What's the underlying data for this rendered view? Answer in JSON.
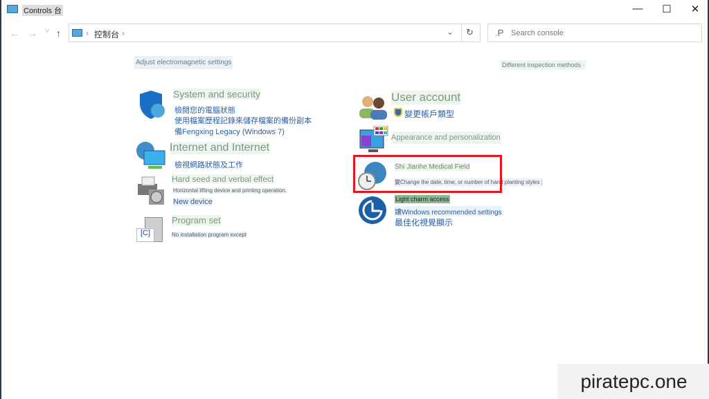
{
  "window": {
    "title": "Controls 台",
    "minimize": "—",
    "maximize": "☐",
    "close": "✕"
  },
  "nav": {
    "back": "←",
    "forward": "→",
    "recent": "˅",
    "up": "↑"
  },
  "address": {
    "crumbs": [
      "›",
      "控制台",
      "›"
    ],
    "dropdown": "⌄",
    "refresh": "↻"
  },
  "search": {
    "icon": ".P",
    "placeholder": "Search console"
  },
  "left_link": "Adjust electromagnetic settings",
  "view_by": "Different inspection methods ·",
  "left": [
    {
      "title": "System and security",
      "lines": [
        "檢閱您的電腦狀態",
        "使用檔案歷程記錄來儲存檔案的備份副本",
        "備Fengxing Legacy (Windows 7)"
      ]
    },
    {
      "title": "Internet and Internet",
      "lines": [
        "檢視網路狀態及工作"
      ]
    },
    {
      "title": "Hard seed and verbal effect",
      "lines": [
        "Horizontal lifting device and printing operation.",
        "New device"
      ]
    },
    {
      "title": "Program set",
      "lines": [
        "No installation program except"
      ]
    }
  ],
  "right": [
    {
      "title": "User account",
      "lines": [
        "變更帳戶類型"
      ]
    },
    {
      "title": "Appearance and personalization",
      "lines": []
    },
    {
      "title": "Shi Jianhe Medical Field",
      "lines": [
        "變Change the date, time, or number of hand planting styles ;"
      ]
    },
    {
      "title": "Light charm access",
      "lines": [
        "讓Windows recommended settings",
        "最佳化視覺顯示"
      ]
    }
  ],
  "watermark": "piratepc.one",
  "colors": {
    "highlight": "#e8131d",
    "link": "#2e5fa0"
  }
}
